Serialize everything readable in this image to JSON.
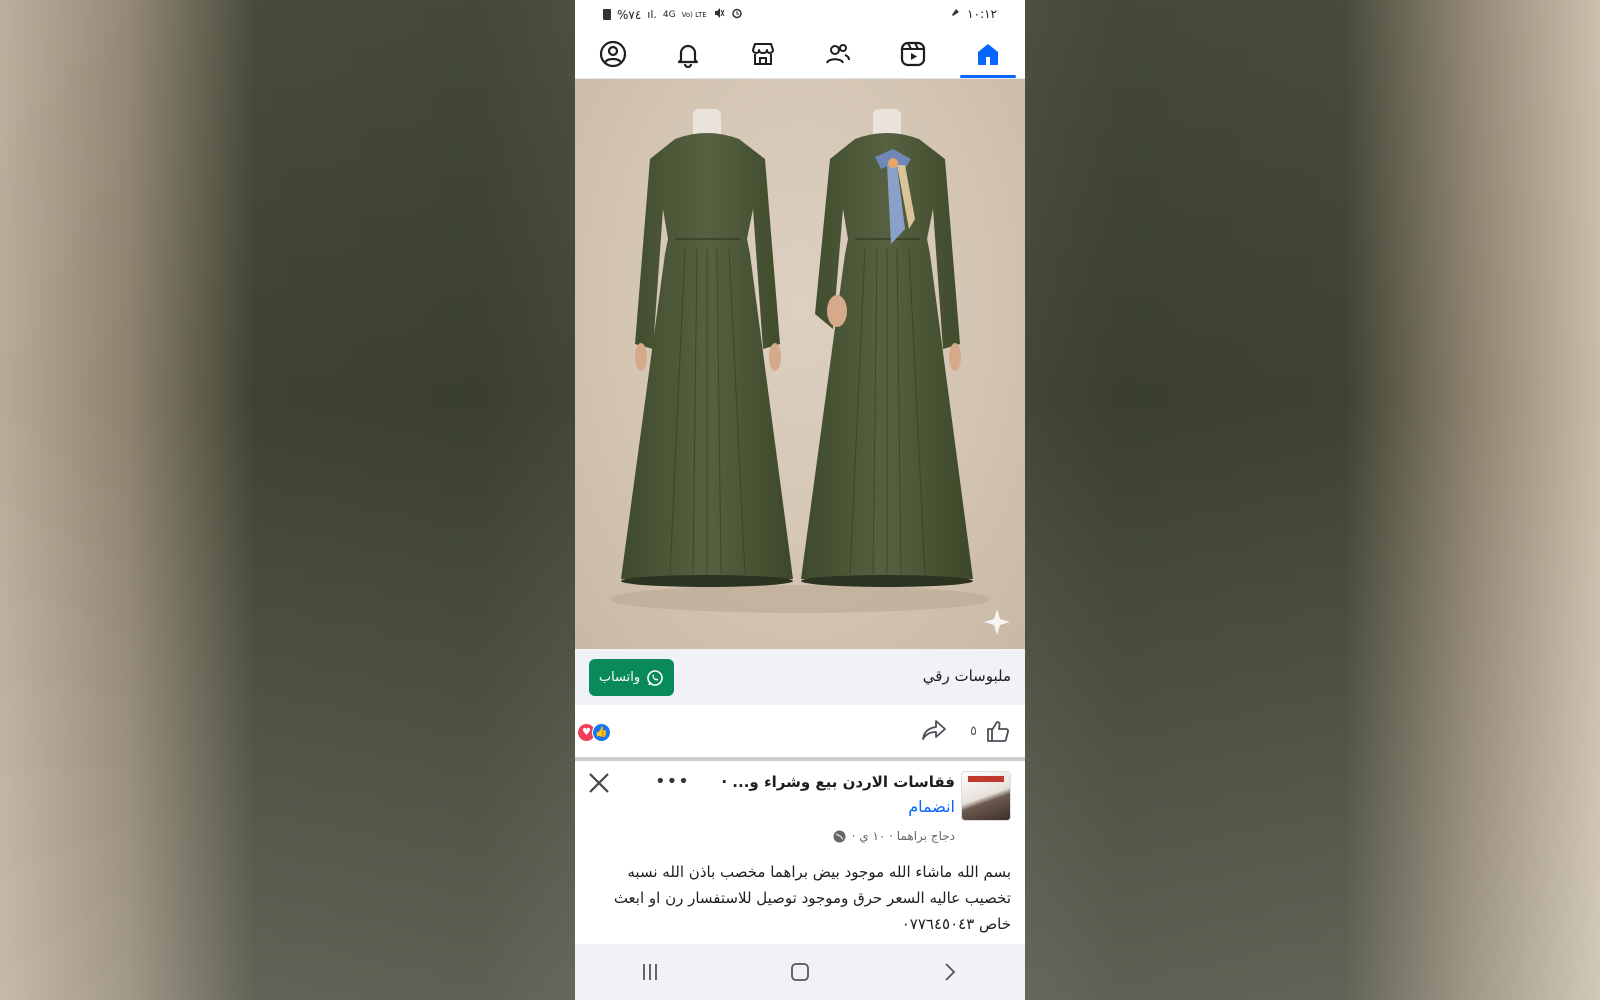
{
  "status_bar": {
    "time": "١٠:١٢",
    "battery": "%٧٤",
    "network": "4G",
    "volte": "Vo) LTE"
  },
  "nav": {
    "items": [
      {
        "name": "profile",
        "icon": "profile-icon"
      },
      {
        "name": "notifications",
        "icon": "bell-icon"
      },
      {
        "name": "marketplace",
        "icon": "store-icon"
      },
      {
        "name": "friends",
        "icon": "friends-icon"
      },
      {
        "name": "video",
        "icon": "video-icon"
      },
      {
        "name": "home",
        "icon": "home-icon",
        "active": true
      }
    ]
  },
  "ad": {
    "page_name": "ملبوسات رقي",
    "cta_label": "واتساب",
    "like_count": "٥"
  },
  "post": {
    "group_name": "فقاسات الاردن بيع وشراء و... ·",
    "join_label": "انضمام",
    "meta": "دجاج براهما · ١٠ ي ·",
    "text": "بسم الله ماشاء الله موجود بيض براهما مخصب باذن الله نسبه تخصيب عاليه السعر حرق وموجود توصيل للاستفسار رن او ابعث خاص ٠٧٧٦٤٥٠٤٣"
  },
  "colors": {
    "accent": "#0866ff",
    "whatsapp": "#0a8a5a",
    "dress": "#4b5535"
  }
}
